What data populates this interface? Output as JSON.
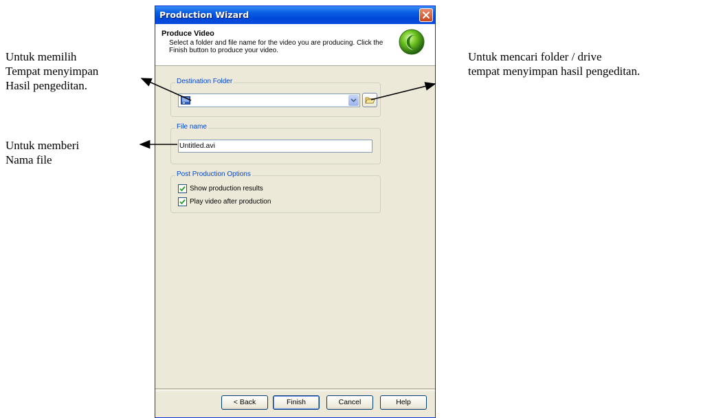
{
  "annotations": {
    "left_1": [
      "Untuk memilih",
      "Tempat menyimpan",
      "Hasil pengeditan."
    ],
    "left_2": [
      "Untuk memberi",
      "Nama file"
    ],
    "right": [
      "Untuk mencari folder / drive",
      "tempat menyimpan hasil pengeditan."
    ]
  },
  "window": {
    "title": "Production Wizard",
    "header": {
      "title": "Produce Video",
      "description": "Select a folder and file name for the video you are producing.  Click the Finish button to produce your video.",
      "icon": "green-orb-logo-icon"
    },
    "destination": {
      "label": "Destination Folder",
      "value": "",
      "icon": "drive-icon",
      "browse_icon": "open-folder-icon"
    },
    "file_name": {
      "label": "File name",
      "value": "Untitled.avi"
    },
    "post_production": {
      "label": "Post Production Options",
      "options": [
        {
          "label": "Show production results",
          "checked": true
        },
        {
          "label": "Play video after production",
          "checked": true
        }
      ]
    },
    "buttons": {
      "back": "< Back",
      "finish": "Finish",
      "cancel": "Cancel",
      "help": "Help"
    }
  }
}
